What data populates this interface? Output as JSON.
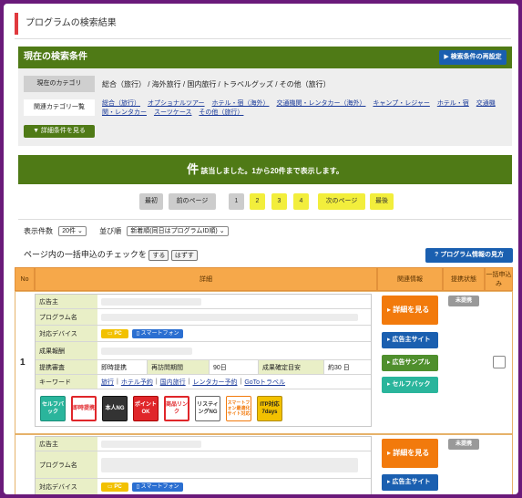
{
  "page": {
    "title": "プログラムの検索結果"
  },
  "conditions": {
    "header": "現在の検索条件",
    "re_search_button": "▶ 検索条件の再設定",
    "category_label": "現在のカテゴリ",
    "category_value": "総合（旅行）  /  海外旅行  /  国内旅行  /  トラベルグッズ  /  その他（旅行）",
    "related_label": "関連カテゴリ一覧",
    "related_links": [
      "総合（旅行）",
      "オプショナルツアー",
      "ホテル・宿（海外）",
      "交通機関・レンタカー（海外）",
      "キャンプ・レジャー",
      "ホテル・宿",
      "交通機関・レンタカー",
      "スーツケース",
      "その他（旅行）"
    ],
    "detail_button": "▼ 詳細条件を見る"
  },
  "results": {
    "count_big": "件",
    "count_text": " 該当しました。1から20件まで表示します。"
  },
  "pager": {
    "first": "最初",
    "prev": "前のページ",
    "pages": [
      "1",
      "2",
      "3",
      "4"
    ],
    "next": "次のページ",
    "last": "最後",
    "current": 1
  },
  "sort": {
    "per_page_label": "表示件数",
    "per_page_value": "20件 ⌄",
    "order_label": "並び順",
    "order_value": "新着順(同日はプログラムID順) ⌄"
  },
  "bulk": {
    "text": "ページ内の一括申込のチェックを",
    "on": "する",
    "off": "はずす",
    "guide_button": "? プログラム情報の見方"
  },
  "table": {
    "headers": {
      "no": "No",
      "detail": "詳細",
      "related": "関連情報",
      "status": "提携状態",
      "bulk": "一括申込み"
    },
    "rows": [
      {
        "no": "1",
        "labels": {
          "advertiser": "広告主",
          "program": "プログラム名",
          "devices": "対応デバイス",
          "reward": "成果報酬",
          "terms": "提携審査",
          "keyword": "キーワード"
        },
        "device_pc": "PC",
        "device_sp": "スマートフォン",
        "terms": {
          "review": "即時提携",
          "period_label": "再訪問期間",
          "period": "90日",
          "confirm_label": "成果確定目安",
          "confirm": "約30 日"
        },
        "keywords": [
          "旅行",
          "ホテル予約",
          "国内旅行",
          "レンタカー予約",
          "GoToトラベル"
        ],
        "badges": [
          {
            "icon": "selfback-badge",
            "text": "セルフバック",
            "bg": "#2ab59c",
            "fg": "#fff"
          },
          {
            "icon": "instant-badge",
            "text": "即時提携",
            "bg": "#fff",
            "fg": "#e0262a"
          },
          {
            "icon": "identity-ng-badge",
            "text": "本人NG",
            "bg": "#333",
            "fg": "#fff"
          },
          {
            "icon": "point-ok-badge",
            "text": "ポイントOK",
            "bg": "#e0262a",
            "fg": "#fff"
          },
          {
            "icon": "product-link-badge",
            "text": "商品リンク",
            "bg": "#fff",
            "fg": "#e0262a"
          },
          {
            "icon": "listing-ng-badge",
            "text": "リスティングNG",
            "bg": "#fff",
            "fg": "#333"
          },
          {
            "icon": "smartphone-site-badge",
            "text": "スマートフォン最適化サイト対応",
            "bg": "#fff",
            "fg": "#f27a0c"
          },
          {
            "icon": "itp-badge",
            "text": "ITP対応 7days",
            "bg": "#f2c100",
            "fg": "#222"
          }
        ],
        "actions": [
          "▸ 詳細を見る",
          "▸ 広告主サイト",
          "▸ 広告サンプル",
          "▸ セルフバック"
        ],
        "status": "未提携"
      },
      {
        "no": "",
        "labels": {
          "advertiser": "広告主",
          "program": "プログラム名",
          "devices": "対応デバイス"
        },
        "device_pc": "PC",
        "device_sp": "スマートフォン",
        "actions": [
          "▸ 詳細を見る",
          "▸ 広告主サイト"
        ],
        "status": "未提携"
      }
    ]
  }
}
